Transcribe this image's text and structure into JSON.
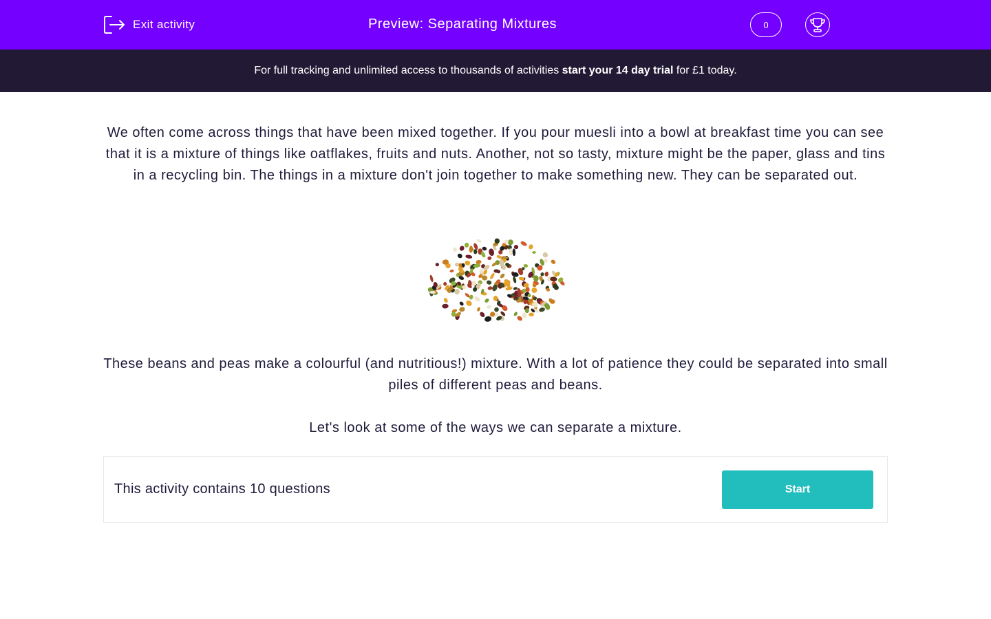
{
  "header": {
    "exit_label": "Exit activity",
    "title": "Preview: Separating Mixtures",
    "score": "0",
    "exit_icon": "exit-door-icon",
    "trophy_icon": "trophy-icon"
  },
  "banner": {
    "text_before": "For full tracking and unlimited access to thousands of activities ",
    "link_text": "start your 14 day trial",
    "text_after": " for £1 today."
  },
  "content": {
    "intro": "We often come across things that have been mixed together. If you pour muesli into a bowl at breakfast time you can see that it is a mixture of things like oatflakes, fruits and nuts. Another, not so tasty, mixture might be the paper, glass and tins in a recycling bin. The things in a mixture don't join together to make something new. They can be separated out.",
    "caption": "These beans and peas make a colourful (and nutritious!) mixture. With a lot of patience they could be separated into small piles of different peas and beans.",
    "look_at": "Let's look at some of the ways we can separate a mixture."
  },
  "activity": {
    "questions_text": "This activity contains 10 questions",
    "start_label": "Start"
  },
  "colors": {
    "header_bg": "#7400ff",
    "banner_bg": "#221a35",
    "start_button": "#22bdbd",
    "body_text": "#1e1b3a"
  }
}
